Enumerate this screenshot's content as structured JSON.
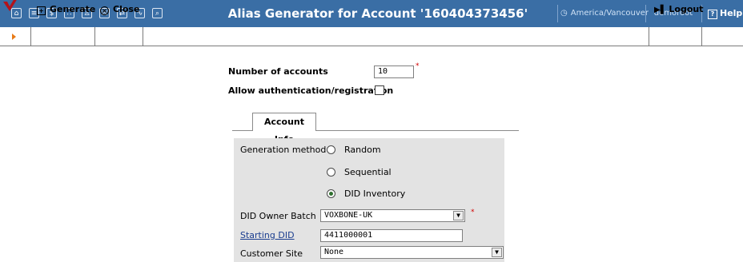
{
  "header": {
    "title": "Alias Generator for Account '160404373456'",
    "timezone": "America/Vancouver",
    "user": "demoroot",
    "help": "Help",
    "nav_icons": [
      "home-icon",
      "list-icon",
      "dollar-icon",
      "grid-icon",
      "person-icon",
      "phone-icon",
      "transfer-icon",
      "chart-icon",
      "search-icon"
    ]
  },
  "toolbar": {
    "generate": "Generate",
    "close": "Close",
    "logout": "Logout"
  },
  "form": {
    "num_accounts_label": "Number of accounts",
    "num_accounts_value": "10",
    "allow_auth_label": "Allow authentication/registration",
    "required_mark": "*"
  },
  "tab": {
    "label": "Account Info"
  },
  "account_info": {
    "generation_method_label": "Generation method",
    "options": [
      "Random",
      "Sequential",
      "DID Inventory"
    ],
    "selected_option": "DID Inventory",
    "did_owner_batch_label": "DID Owner Batch",
    "did_owner_batch_value": "VOXBONE-UK",
    "starting_did_label": "Starting DID",
    "starting_did_value": "4411000001",
    "customer_site_label": "Customer Site",
    "customer_site_value": "None"
  },
  "colors": {
    "header_bg": "#3a6ea5",
    "panel_bg": "#e3e3e3",
    "required": "#d20000",
    "accent_arrow": "#e87b18"
  }
}
